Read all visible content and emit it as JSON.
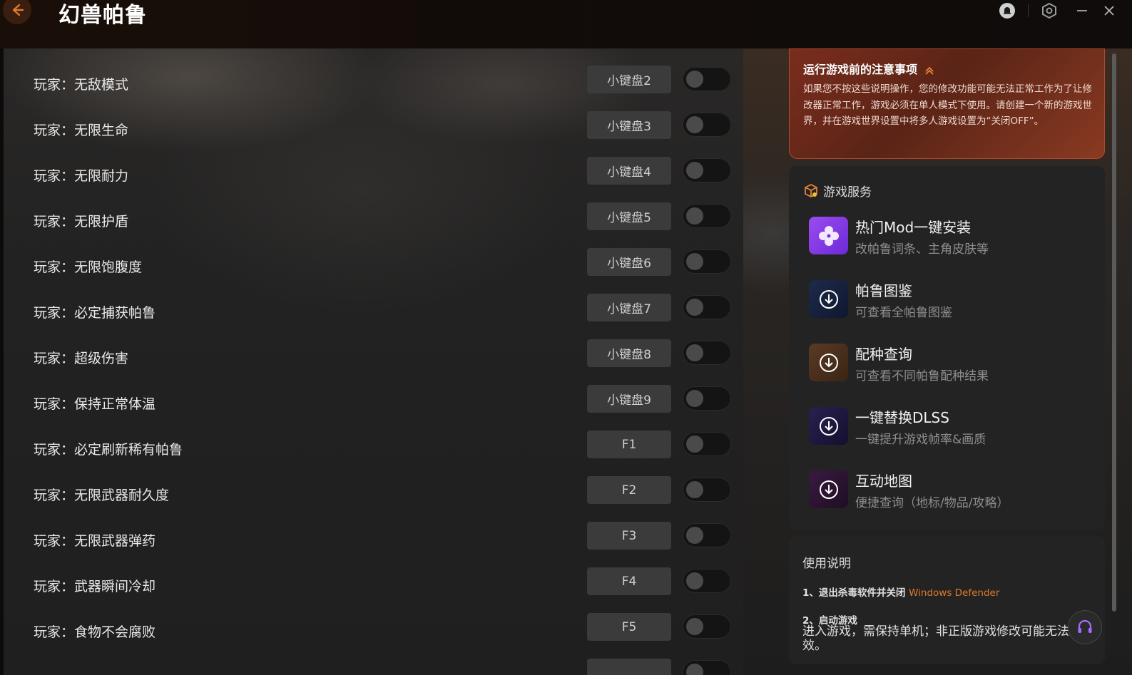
{
  "app": {
    "title": "幻兽帕鲁"
  },
  "colors": {
    "accent": "#e0782a",
    "notice_bg": "#6a2a1a",
    "panel_bg": "#232323"
  },
  "cheats": [
    {
      "label": "玩家：无敌模式",
      "hotkey": "小键盘2",
      "enabled": false
    },
    {
      "label": "玩家：无限生命",
      "hotkey": "小键盘3",
      "enabled": false
    },
    {
      "label": "玩家：无限耐力",
      "hotkey": "小键盘4",
      "enabled": false
    },
    {
      "label": "玩家：无限护盾",
      "hotkey": "小键盘5",
      "enabled": false
    },
    {
      "label": "玩家：无限饱腹度",
      "hotkey": "小键盘6",
      "enabled": false
    },
    {
      "label": "玩家：必定捕获帕鲁",
      "hotkey": "小键盘7",
      "enabled": false
    },
    {
      "label": "玩家：超级伤害",
      "hotkey": "小键盘8",
      "enabled": false
    },
    {
      "label": "玩家：保持正常体温",
      "hotkey": "小键盘9",
      "enabled": false
    },
    {
      "label": "玩家：必定刷新稀有帕鲁",
      "hotkey": "F1",
      "enabled": false
    },
    {
      "label": "玩家：无限武器耐久度",
      "hotkey": "F2",
      "enabled": false
    },
    {
      "label": "玩家：无限武器弹药",
      "hotkey": "F3",
      "enabled": false
    },
    {
      "label": "玩家：武器瞬间冷却",
      "hotkey": "F4",
      "enabled": false
    },
    {
      "label": "玩家：食物不会腐败",
      "hotkey": "F5",
      "enabled": false
    }
  ],
  "notice": {
    "title": "运行游戏前的注意事项",
    "body": "如果您不按这些说明操作，您的修改功能可能无法正常工作为了让修改器正常工作，游戏必须在单人模式下使用。请创建一个新的游戏世界，并在游戏世界设置中将多人游戏设置为“关闭OFF”。"
  },
  "services": {
    "title": "游戏服务",
    "items": [
      {
        "title": "热门Mod一键安装",
        "subtitle": "改帕鲁词条、主角皮肤等",
        "icon": "mod-flower-icon"
      },
      {
        "title": "帕鲁图鉴",
        "subtitle": "可查看全帕鲁图鉴",
        "icon": "download-icon"
      },
      {
        "title": "配种查询",
        "subtitle": "可查看不同帕鲁配种结果",
        "icon": "download-icon"
      },
      {
        "title": "一键替换DLSS",
        "subtitle": "一键提升游戏帧率&画质",
        "icon": "download-icon"
      },
      {
        "title": "互动地图",
        "subtitle": "便捷查询（地标/物品/攻略）",
        "icon": "download-icon"
      }
    ]
  },
  "usage": {
    "title": "使用说明",
    "step1_label": "1、退出杀毒软件并关闭",
    "step1_highlight": "Windows Defender",
    "step2_label": "2、启动游戏",
    "step2_body": "进入游戏，需保持单机；非正版游戏修改可能无法生效。"
  }
}
